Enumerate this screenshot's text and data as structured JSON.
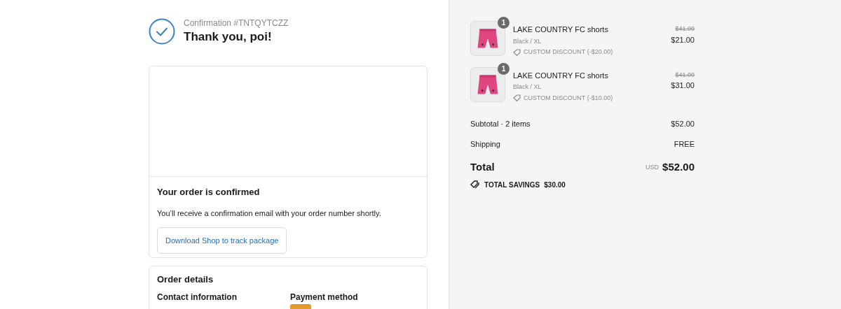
{
  "header": {
    "confirmation": "Confirmation #TNTQYTCZZ",
    "title": "Thank you, poi!"
  },
  "status_card": {
    "title": "Your order is confirmed",
    "message": "You’ll receive a confirmation email with your order number shortly.",
    "button": "Download Shop to track package"
  },
  "order_details": {
    "title": "Order details",
    "contact_heading": "Contact information",
    "payment_heading": "Payment method"
  },
  "items": [
    {
      "name": "LAKE COUNTRY FC shorts",
      "variant": "Black / XL",
      "discount": "CUSTOM DISCOUNT (-$20.00)",
      "original_price": "$41.00",
      "price": "$21.00",
      "quantity": "1"
    },
    {
      "name": "LAKE COUNTRY FC shorts",
      "variant": "Black / XL",
      "discount": "CUSTOM DISCOUNT (-$10.00)",
      "original_price": "$41.00",
      "price": "$31.00",
      "quantity": "1"
    }
  ],
  "summary": {
    "subtotal_label": "Subtotal · 2 items",
    "subtotal": "$52.00",
    "shipping_label": "Shipping",
    "shipping": "FREE",
    "total_label": "Total",
    "currency": "USD",
    "total": "$52.00",
    "savings_label": "TOTAL SAVINGS",
    "savings": "$30.00"
  }
}
